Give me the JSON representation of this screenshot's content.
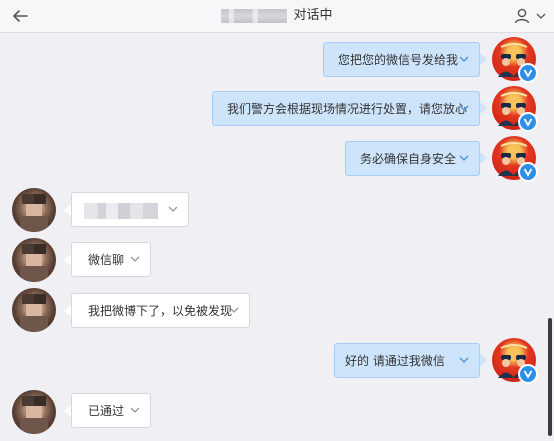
{
  "header": {
    "title": "对话中"
  },
  "messages": [
    {
      "side": "out",
      "text": "您把您的微信号发给我"
    },
    {
      "side": "out",
      "text": "我们警方会根据现场情况进行处置，请您放心"
    },
    {
      "side": "out",
      "text": "务必确保自身安全"
    },
    {
      "side": "in",
      "text": ""
    },
    {
      "side": "in",
      "text": "微信聊"
    },
    {
      "side": "in",
      "text": "我把微博下了，以免被发现"
    },
    {
      "side": "out",
      "text": "好的 请通过我微信"
    },
    {
      "side": "in",
      "text": "已通过"
    }
  ],
  "colors": {
    "outgoing_bubble": "#cde4fb",
    "incoming_bubble": "#ffffff",
    "background": "#efeff4",
    "verified_badge": "#2b8fe8"
  }
}
